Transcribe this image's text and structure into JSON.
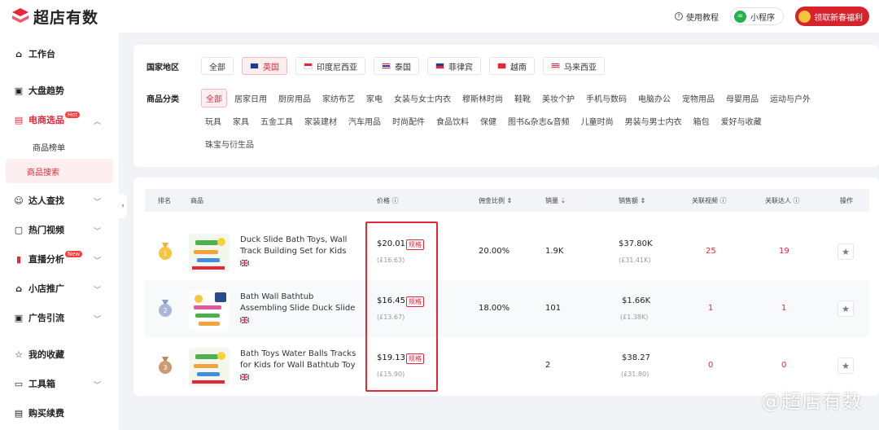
{
  "brand": {
    "name": "超店有数",
    "color": "#e6273a"
  },
  "header": {
    "help": "使用教程",
    "mini": "小程序",
    "promo": "领取新春福利"
  },
  "sidebar": {
    "items": [
      {
        "label": "工作台",
        "icon": "home-icon"
      },
      {
        "label": "大盘趋势",
        "icon": "trend-icon"
      },
      {
        "label": "电商选品",
        "icon": "bag-icon",
        "badge": "Hot"
      },
      {
        "label": "达人查找",
        "icon": "people-icon"
      },
      {
        "label": "热门视频",
        "icon": "video-icon"
      },
      {
        "label": "直播分析",
        "icon": "bar-icon",
        "badge": "New"
      },
      {
        "label": "小店推广",
        "icon": "shop-icon"
      },
      {
        "label": "广告引流",
        "icon": "ad-icon"
      },
      {
        "label": "我的收藏",
        "icon": "star-icon"
      },
      {
        "label": "工具箱",
        "icon": "toolbox-icon"
      },
      {
        "label": "购买续费",
        "icon": "receipt-icon"
      }
    ],
    "sub": [
      "商品榜单",
      "商品搜索"
    ]
  },
  "filters": {
    "country_label": "国家地区",
    "countries": [
      "全部",
      "英国",
      "印度尼西亚",
      "泰国",
      "菲律宾",
      "越南",
      "马来西亚"
    ],
    "category_label": "商品分类",
    "categories_row1": [
      "全部",
      "居家日用",
      "厨房用品",
      "家纺布艺",
      "家电",
      "女装与女士内衣",
      "穆斯林时尚",
      "鞋靴",
      "美妆个护",
      "手机与数码",
      "电脑办公",
      "宠物用品",
      "母婴用品",
      "运动与户外"
    ],
    "categories_row2": [
      "玩具",
      "家具",
      "五金工具",
      "家装建材",
      "汽车用品",
      "时尚配件",
      "食品饮料",
      "保健",
      "图书&杂志&音频",
      "儿童时尚",
      "男装与男士内衣",
      "箱包",
      "爱好与收藏"
    ],
    "categories_row3": [
      "珠宝与衍生品"
    ]
  },
  "table": {
    "headers": {
      "rank": "排名",
      "product": "商品",
      "price": "价格",
      "commission": "佣金比例",
      "sales": "销量",
      "revenue": "销售额",
      "videos": "关联视频",
      "creators": "关联达人",
      "action": "操作"
    },
    "spec_label": "规格",
    "rows": [
      {
        "rank": "1",
        "name": "Duck Slide Bath Toys, Wall Track Building Set for Kids Ages 4...",
        "price": "$20.01",
        "price_gbp": "(£16.63)",
        "commission": "20.00%",
        "sales": "1.9K",
        "revenue": "$37.80K",
        "revenue_gbp": "(£31.41K)",
        "videos": "25",
        "creators": "19"
      },
      {
        "rank": "2",
        "name": "Bath Wall Bathtub Assembling Slide Duck Slide Bathroom S...",
        "price": "$16.45",
        "price_gbp": "(£13.67)",
        "commission": "18.00%",
        "sales": "101",
        "revenue": "$1.66K",
        "revenue_gbp": "(£1.38K)",
        "videos": "1",
        "creators": "1"
      },
      {
        "rank": "3",
        "name": "Bath Toys Water Balls Tracks for Kids for Wall Bathtub Toy Sli...",
        "price": "$19.13",
        "price_gbp": "(£15.90)",
        "commission": "",
        "sales": "2",
        "revenue": "$38.27",
        "revenue_gbp": "(£31.80)",
        "videos": "0",
        "creators": "0"
      }
    ]
  },
  "watermark": "@超店有数"
}
